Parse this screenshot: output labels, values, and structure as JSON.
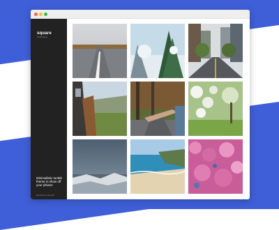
{
  "sidebar": {
    "logo": "square",
    "logo_sub": "tumblr theme",
    "tagline": "Minimalistic tumblr theme to show off your photos",
    "footer_small": "My photos on the web",
    "social_icons": [
      "instagram-icon",
      "flickr-icon",
      "twitter-icon",
      "linkedin-icon"
    ]
  },
  "photos": [
    "road-photo",
    "snowy-forest-photo",
    "city-street-photo",
    "train-valley-photo",
    "hand-forest-road-photo",
    "blossom-orchard-photo",
    "stormy-sea-photo",
    "beach-coast-photo",
    "pink-blossom-photo"
  ],
  "colors": {
    "background_accent": "#3f5fd8",
    "sidebar": "#222222"
  }
}
